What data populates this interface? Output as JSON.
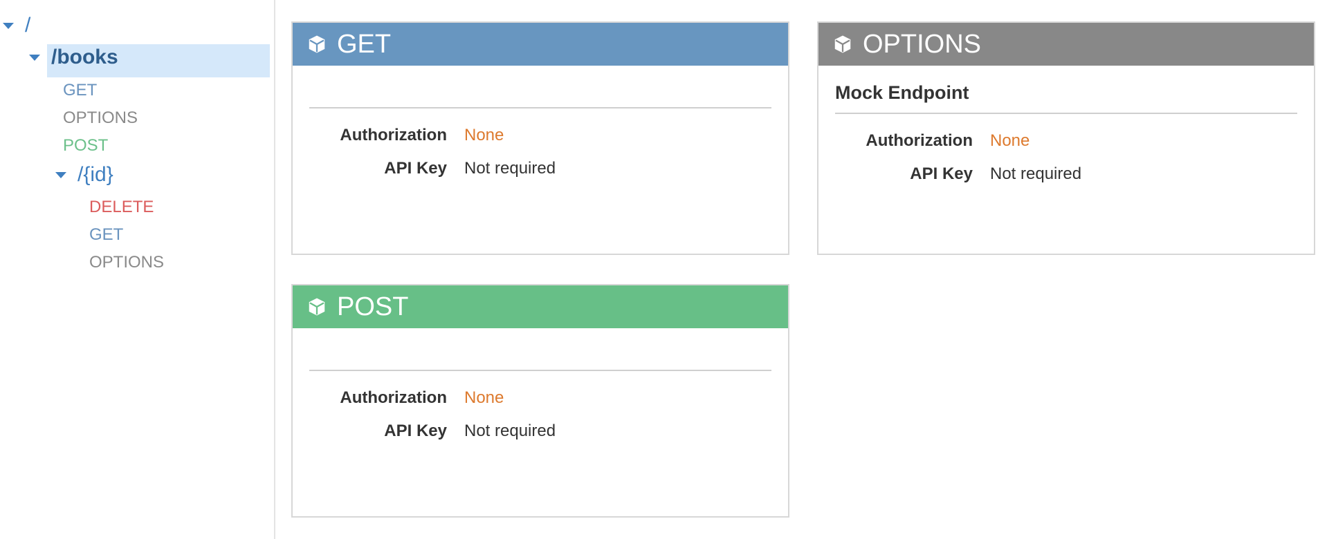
{
  "tree": {
    "root_label": "/",
    "books_label": "/books",
    "books_methods": [
      {
        "label": "GET",
        "color": "#6a93be"
      },
      {
        "label": "OPTIONS",
        "color": "#8a8a8a"
      },
      {
        "label": "POST",
        "color": "#6cc08a"
      }
    ],
    "id_label": "/{id}",
    "id_methods": [
      {
        "label": "DELETE",
        "color": "#db5c5c"
      },
      {
        "label": "GET",
        "color": "#6a93be"
      },
      {
        "label": "OPTIONS",
        "color": "#8a8a8a"
      }
    ]
  },
  "cards": {
    "get": {
      "title": "GET",
      "header_color": "#6896c0",
      "subtitle": "",
      "auth_label": "Authorization",
      "auth_value": "None",
      "apikey_label": "API Key",
      "apikey_value": "Not required"
    },
    "options": {
      "title": "OPTIONS",
      "header_color": "#888888",
      "subtitle": "Mock Endpoint",
      "auth_label": "Authorization",
      "auth_value": "None",
      "apikey_label": "API Key",
      "apikey_value": "Not required"
    },
    "post": {
      "title": "POST",
      "header_color": "#67bf87",
      "subtitle": "",
      "auth_label": "Authorization",
      "auth_value": "None",
      "apikey_label": "API Key",
      "apikey_value": "Not required"
    }
  },
  "colors": {
    "none_value": "#dd7a2e",
    "resource": "#3f7fc0"
  }
}
